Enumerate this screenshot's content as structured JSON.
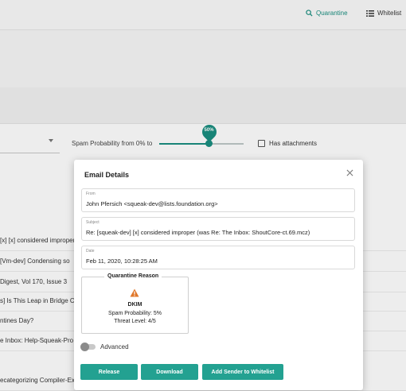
{
  "nav": {
    "quarantine_label": "Quarantine",
    "whitelist_label": "Whitelist",
    "quarantine_icon": "search-icon",
    "whitelist_icon": "list-icon",
    "accent_color": "#1a8f80"
  },
  "filters": {
    "spam_label": "Spam Probability from 0% to",
    "slider_value_label": "50%",
    "slider_value": 0.5,
    "attachments_label": "Has attachments",
    "attachments_checked": false
  },
  "list": {
    "rows": [
      "[x] [x] considered improper",
      "[Vm-dev] Condensing so",
      "Digest, Vol 170, Issue 3",
      "s] Is This Leap in Bridge C",
      "ntines Day?",
      "e Inbox: Help-Squeak-Pro",
      "ecategorizing Compiler-Ex"
    ]
  },
  "modal": {
    "title": "Email Details",
    "from_label": "From",
    "from_value": "John Pfersich <squeak-dev@lists.foundation.org>",
    "subject_label": "Subject",
    "subject_value": "Re: [squeak-dev] [x] considered improper (was Re: The Inbox:  ShoutCore-ct.69.mcz)",
    "date_label": "Date",
    "date_value": "Feb 11, 2020, 10:28:25 AM",
    "reason_title": "Quarantine Reason",
    "reason_icon": "warning-icon",
    "reason_code": "DKIM",
    "reason_probability": "Spam Probability: 5%",
    "reason_threat": "Threat Level: 4/5",
    "advanced_label": "Advanced",
    "advanced_on": false,
    "buttons": {
      "release": "Release",
      "download": "Download",
      "whitelist": "Add Sender to Whitelist"
    }
  }
}
